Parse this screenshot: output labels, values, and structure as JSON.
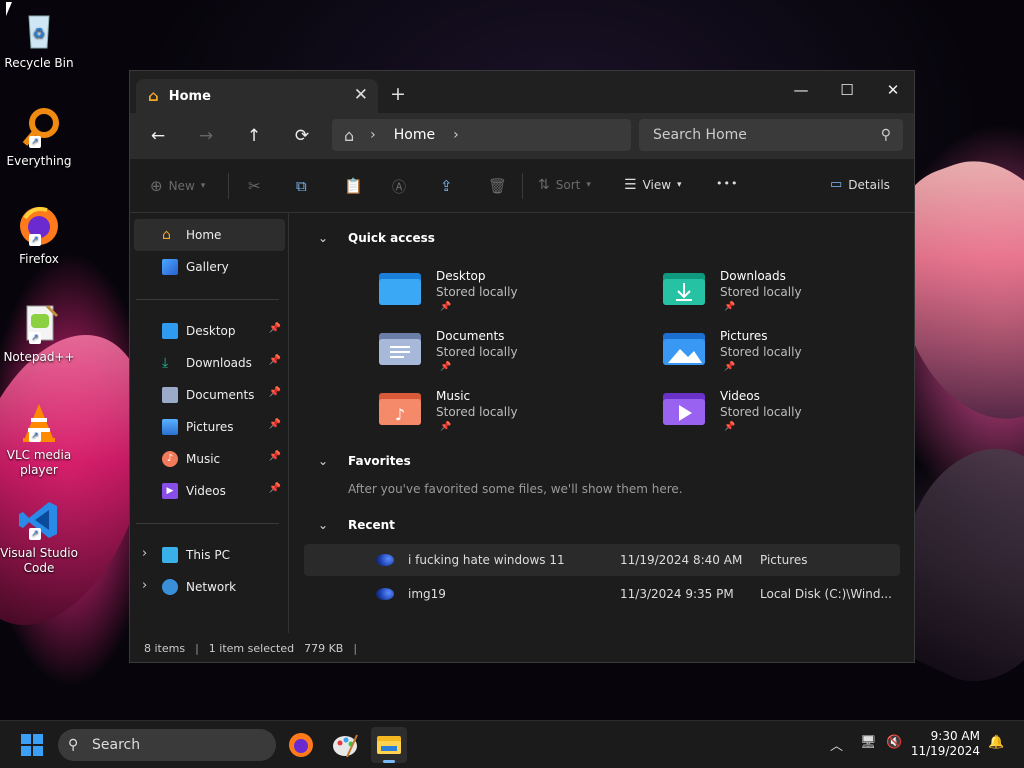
{
  "desktop": {
    "icons": [
      {
        "label": "Recycle Bin",
        "icon": "recycle-bin-icon"
      },
      {
        "label": "Everything",
        "icon": "everything-icon"
      },
      {
        "label": "Firefox",
        "icon": "firefox-icon"
      },
      {
        "label": "Notepad++",
        "icon": "notepad-plus-plus-icon"
      },
      {
        "label": "VLC media player",
        "icon": "vlc-icon"
      },
      {
        "label": "Visual Studio Code",
        "icon": "vscode-icon"
      }
    ]
  },
  "explorer": {
    "tab": {
      "title": "Home",
      "close": "✕",
      "new_tab": "+"
    },
    "window_controls": {
      "minimize": "—",
      "maximize": "☐",
      "close": "✕"
    },
    "nav": {
      "back": "←",
      "forward": "→",
      "up": "↑",
      "refresh": "⟳"
    },
    "address": {
      "home_icon": "⌂",
      "sep": "›",
      "current": "Home",
      "trailing": "›"
    },
    "search": {
      "placeholder": "Search Home",
      "icon": "⚲"
    },
    "commands": {
      "new": "New",
      "sort": "Sort",
      "view": "View",
      "more": "•••",
      "details": "Details"
    },
    "sidebar": {
      "top": [
        {
          "label": "Home"
        },
        {
          "label": "Gallery"
        }
      ],
      "pinned": [
        {
          "label": "Desktop"
        },
        {
          "label": "Downloads"
        },
        {
          "label": "Documents"
        },
        {
          "label": "Pictures"
        },
        {
          "label": "Music"
        },
        {
          "label": "Videos"
        }
      ],
      "bottom": [
        {
          "label": "This PC"
        },
        {
          "label": "Network"
        }
      ],
      "pin_glyph": "📌",
      "expand_glyph": "›"
    },
    "quick_access": {
      "title": "Quick access",
      "items": [
        {
          "name": "Desktop",
          "status": "Stored locally",
          "color": "#2e9bf0"
        },
        {
          "name": "Downloads",
          "status": "Stored locally",
          "color": "#1fb89a"
        },
        {
          "name": "Documents",
          "status": "Stored locally",
          "color": "#9aaac8"
        },
        {
          "name": "Pictures",
          "status": "Stored locally",
          "color": "#2d8ef0"
        },
        {
          "name": "Music",
          "status": "Stored locally",
          "color": "#f07a5a"
        },
        {
          "name": "Videos",
          "status": "Stored locally",
          "color": "#8a4ee8"
        }
      ]
    },
    "favorites": {
      "title": "Favorites",
      "empty": "After you've favorited some files, we'll show them here."
    },
    "recent": {
      "title": "Recent",
      "items": [
        {
          "name": "i fucking hate windows 11",
          "date": "11/19/2024 8:40 AM",
          "location": "Pictures"
        },
        {
          "name": "img19",
          "date": "11/3/2024 9:35 PM",
          "location": "Local Disk (C:)\\Wind..."
        }
      ]
    },
    "status": {
      "items": "8 items",
      "selected": "1 item selected",
      "size": "779 KB",
      "sep": "|"
    }
  },
  "taskbar": {
    "search_label": "Search",
    "tray_chevron": "︿",
    "time": "9:30 AM",
    "date": "11/19/2024"
  }
}
